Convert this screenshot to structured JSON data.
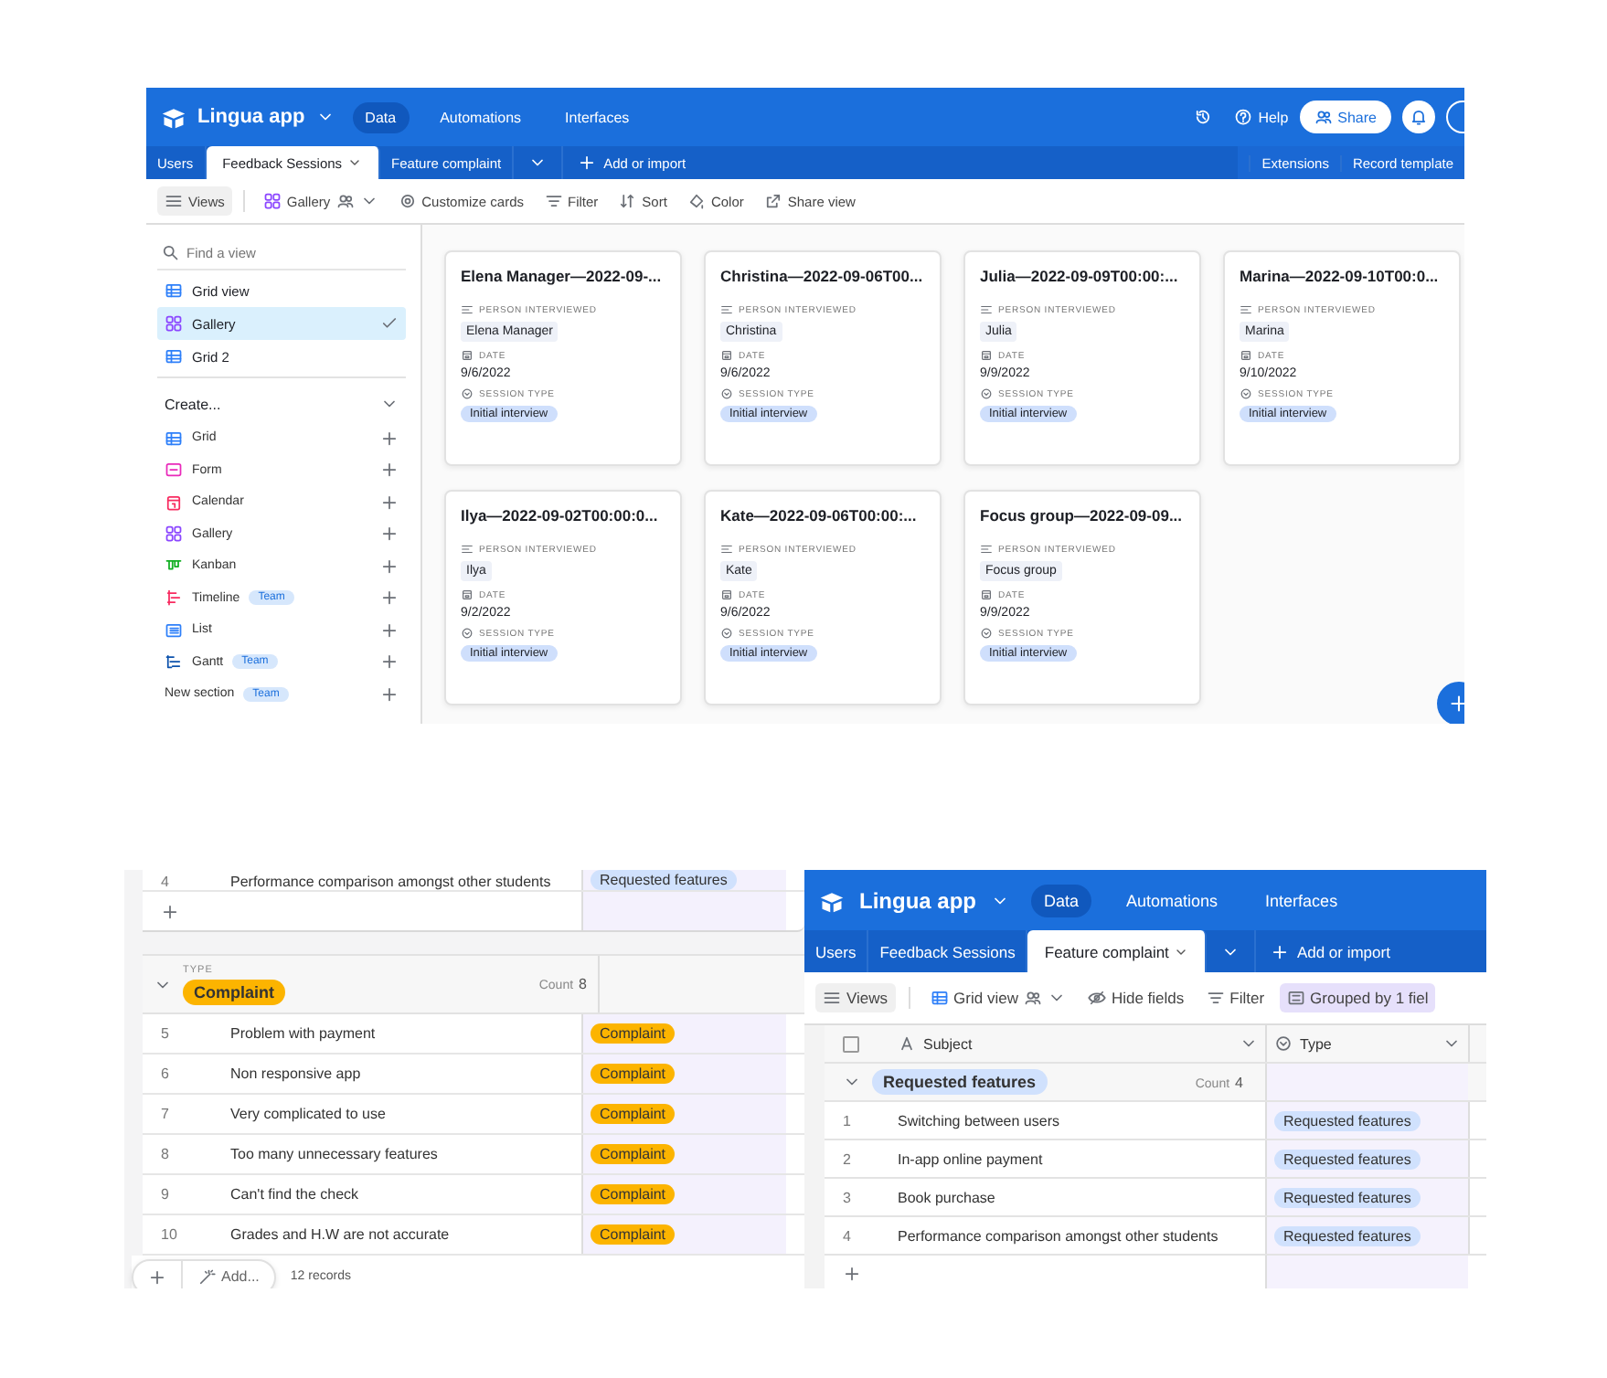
{
  "gallery_screen": {
    "header": {
      "app_name": "Lingua app",
      "nav": [
        {
          "label": "Data",
          "selected": true
        },
        {
          "label": "Automations",
          "selected": false
        },
        {
          "label": "Interfaces",
          "selected": false
        }
      ],
      "help": "Help",
      "share": "Share"
    },
    "tabs": [
      {
        "label": "Users",
        "selected": false
      },
      {
        "label": "Feedback Sessions",
        "selected": true
      },
      {
        "label": "Feature complaint",
        "selected": false
      }
    ],
    "add_label": "Add or import",
    "right_tabs": [
      "Extensions",
      "Record template"
    ],
    "toolbar": {
      "views": "Views",
      "view": {
        "label": "Gallery",
        "kind": "gallery"
      },
      "tools": [
        {
          "label": "Customize cards",
          "kind": "customize",
          "active": false
        },
        {
          "label": "Filter",
          "kind": "filter",
          "active": false
        },
        {
          "label": "Sort",
          "kind": "sort",
          "active": false
        },
        {
          "label": "Color",
          "kind": "color",
          "active": false
        },
        {
          "label": "Share view",
          "kind": "share",
          "active": false
        }
      ]
    },
    "sidebar": {
      "search_placeholder": "Find a view",
      "views": [
        {
          "label": "Grid view",
          "kind": "grid",
          "selected": false
        },
        {
          "label": "Gallery",
          "kind": "gallery",
          "selected": true
        },
        {
          "label": "Grid 2",
          "kind": "grid",
          "selected": false
        }
      ],
      "create_label": "Create...",
      "create_items": [
        {
          "label": "Grid",
          "kind": "grid"
        },
        {
          "label": "Form",
          "kind": "form"
        },
        {
          "label": "Calendar",
          "kind": "calendar"
        },
        {
          "label": "Gallery",
          "kind": "gallery"
        },
        {
          "label": "Kanban",
          "kind": "kanban"
        },
        {
          "label": "Timeline",
          "kind": "timeline",
          "badge": "Team"
        },
        {
          "label": "List",
          "kind": "list"
        },
        {
          "label": "Gantt",
          "kind": "gantt",
          "badge": "Team"
        },
        {
          "label": "New section",
          "kind": "section",
          "badge": "Team"
        }
      ]
    },
    "cards": [
      {
        "title": "Elena Manager—2022-09-...",
        "fields": [
          {
            "label": "PERSON INTERVIEWED",
            "kind": "text",
            "value": "Elena Manager"
          },
          {
            "label": "DATE",
            "kind": "date",
            "value": "9/6/2022"
          },
          {
            "label": "SESSION TYPE",
            "kind": "select",
            "value": "Initial interview"
          }
        ]
      },
      {
        "title": "Christina—2022-09-06T00...",
        "fields": [
          {
            "label": "PERSON INTERVIEWED",
            "kind": "text",
            "value": "Christina"
          },
          {
            "label": "DATE",
            "kind": "date",
            "value": "9/6/2022"
          },
          {
            "label": "SESSION TYPE",
            "kind": "select",
            "value": "Initial interview"
          }
        ]
      },
      {
        "title": "Julia—2022-09-09T00:00:...",
        "fields": [
          {
            "label": "PERSON INTERVIEWED",
            "kind": "text",
            "value": "Julia"
          },
          {
            "label": "DATE",
            "kind": "date",
            "value": "9/9/2022"
          },
          {
            "label": "SESSION TYPE",
            "kind": "select",
            "value": "Initial interview"
          }
        ]
      },
      {
        "title": "Marina—2022-09-10T00:0...",
        "fields": [
          {
            "label": "PERSON INTERVIEWED",
            "kind": "text",
            "value": "Marina"
          },
          {
            "label": "DATE",
            "kind": "date",
            "value": "9/10/2022"
          },
          {
            "label": "SESSION TYPE",
            "kind": "select",
            "value": "Initial interview"
          }
        ]
      },
      {
        "title": "Ilya—2022-09-02T00:00:0...",
        "fields": [
          {
            "label": "PERSON INTERVIEWED",
            "kind": "text",
            "value": "Ilya"
          },
          {
            "label": "DATE",
            "kind": "date",
            "value": "9/2/2022"
          },
          {
            "label": "SESSION TYPE",
            "kind": "select",
            "value": "Initial interview"
          }
        ]
      },
      {
        "title": "Kate—2022-09-06T00:00:...",
        "fields": [
          {
            "label": "PERSON INTERVIEWED",
            "kind": "text",
            "value": "Kate"
          },
          {
            "label": "DATE",
            "kind": "date",
            "value": "9/6/2022"
          },
          {
            "label": "SESSION TYPE",
            "kind": "select",
            "value": "Initial interview"
          }
        ]
      },
      {
        "title": "Focus group—2022-09-09...",
        "fields": [
          {
            "label": "PERSON INTERVIEWED",
            "kind": "text",
            "value": "Focus group"
          },
          {
            "label": "DATE",
            "kind": "date",
            "value": "9/9/2022"
          },
          {
            "label": "SESSION TYPE",
            "kind": "select",
            "value": "Initial interview"
          }
        ]
      }
    ]
  },
  "grouped_grid": {
    "top_row": {
      "number": "4",
      "subject": "Performance comparison amongst other students",
      "type": {
        "label": "Requested features",
        "color": "#d0e1fd"
      }
    },
    "group": {
      "field": "TYPE",
      "label": "Complaint",
      "color": "#fcb400",
      "count_label": "Count",
      "count": "8",
      "expanded": true
    },
    "rows": [
      {
        "number": "5",
        "subject": "Problem with payment",
        "type": {
          "label": "Complaint",
          "color": "#fcb400"
        }
      },
      {
        "number": "6",
        "subject": "Non responsive app",
        "type": {
          "label": "Complaint",
          "color": "#fcb400"
        }
      },
      {
        "number": "7",
        "subject": "Very complicated to use",
        "type": {
          "label": "Complaint",
          "color": "#fcb400"
        }
      },
      {
        "number": "8",
        "subject": "Too many unnecessary features",
        "type": {
          "label": "Complaint",
          "color": "#fcb400"
        }
      },
      {
        "number": "9",
        "subject": "Can't find the check",
        "type": {
          "label": "Complaint",
          "color": "#fcb400"
        }
      },
      {
        "number": "10",
        "subject": "Grades and H.W are not accurate",
        "type": {
          "label": "Complaint",
          "color": "#fcb400"
        }
      }
    ],
    "add_label": "Add...",
    "records": "12 records"
  },
  "grid_screen": {
    "header": {
      "app_name": "Lingua app",
      "nav": [
        {
          "label": "Data",
          "selected": true
        },
        {
          "label": "Automations",
          "selected": false
        },
        {
          "label": "Interfaces",
          "selected": false
        }
      ]
    },
    "tabs": [
      {
        "label": "Users",
        "selected": false
      },
      {
        "label": "Feedback Sessions",
        "selected": false
      },
      {
        "label": "Feature complaint",
        "selected": true
      }
    ],
    "add_label": "Add or import",
    "toolbar": {
      "views": "Views",
      "view": {
        "label": "Grid view",
        "kind": "grid"
      },
      "tools": [
        {
          "label": "Hide fields",
          "kind": "hide",
          "active": false
        },
        {
          "label": "Filter",
          "kind": "filter",
          "active": false
        },
        {
          "label": "Grouped by 1 fiel",
          "kind": "group",
          "active": true
        }
      ]
    },
    "select_all": {
      "checked": false
    },
    "columns": [
      {
        "label": "Subject",
        "kind": "text"
      },
      {
        "label": "Type",
        "kind": "select"
      }
    ],
    "group": {
      "label": "Requested features",
      "color": "#d0e1fd",
      "count_label": "Count",
      "count": "4",
      "expanded": true
    },
    "rows": [
      {
        "number": "1",
        "subject": "Switching between users",
        "type": {
          "label": "Requested features",
          "color": "#d0e1fd"
        }
      },
      {
        "number": "2",
        "subject": "In-app online payment",
        "type": {
          "label": "Requested features",
          "color": "#d0e1fd"
        }
      },
      {
        "number": "3",
        "subject": "Book purchase",
        "type": {
          "label": "Requested features",
          "color": "#d0e1fd"
        }
      },
      {
        "number": "4",
        "subject": "Performance comparison amongst other students",
        "type": {
          "label": "Requested features",
          "color": "#d0e1fd"
        }
      }
    ]
  }
}
